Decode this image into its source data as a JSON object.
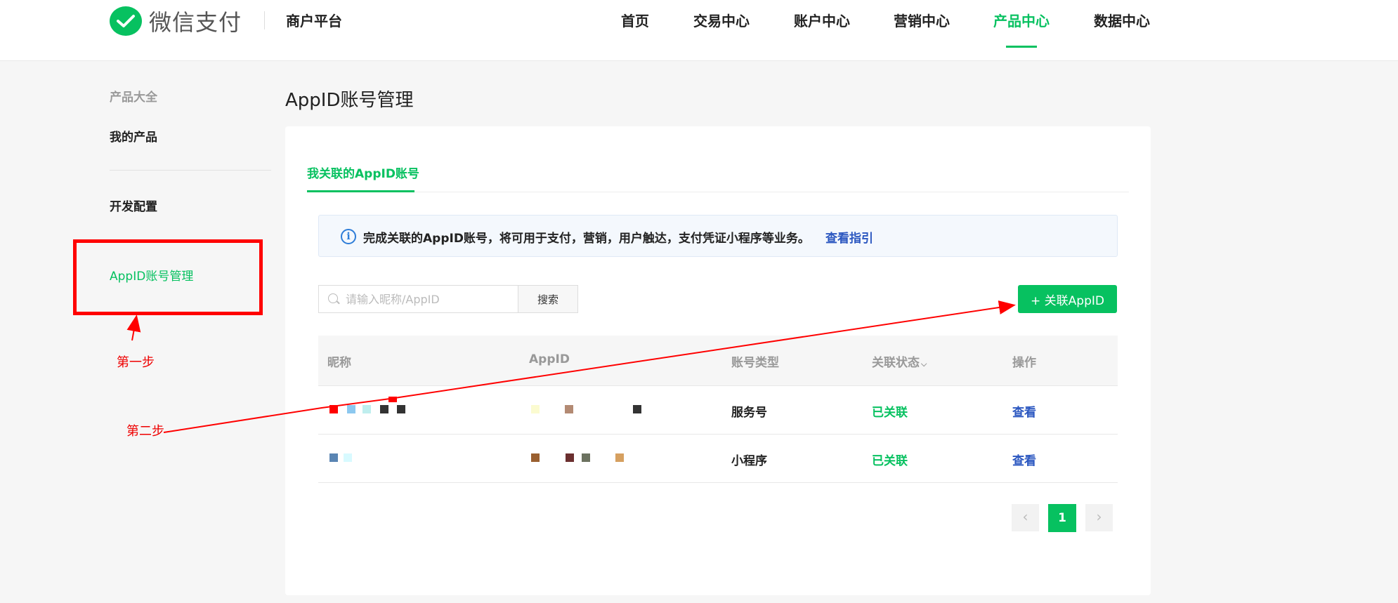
{
  "brand": {
    "name": "微信支付",
    "platform": "商户平台",
    "color": "#07c160"
  },
  "nav": {
    "items": [
      {
        "label": "首页"
      },
      {
        "label": "交易中心"
      },
      {
        "label": "账户中心"
      },
      {
        "label": "营销中心"
      },
      {
        "label": "产品中心",
        "active": true
      },
      {
        "label": "数据中心"
      }
    ]
  },
  "sidebar": {
    "group_label": "产品大全",
    "items": [
      {
        "label": "我的产品"
      },
      {
        "label": "开发配置"
      },
      {
        "label": "AppID账号管理",
        "active": true
      }
    ]
  },
  "annotations": {
    "step1": "第一步",
    "step2": "第二步",
    "color": "#ff0000"
  },
  "main": {
    "title": "AppID账号管理",
    "tab": "我关联的AppID账号",
    "notice": {
      "icon": "info-icon",
      "text": "完成关联的AppID账号，将可用于支付，营销，用户触达，支付凭证小程序等业务。",
      "link": "查看指引"
    },
    "search": {
      "placeholder": "请输入昵称/AppID",
      "button": "搜索"
    },
    "add_button": "+ 关联AppID",
    "table": {
      "headers": [
        "昵称",
        "AppID",
        "账号类型",
        "关联状态",
        "操作"
      ],
      "rows": [
        {
          "type": "服务号",
          "status": "已关联",
          "action": "查看"
        },
        {
          "type": "小程序",
          "status": "已关联",
          "action": "查看"
        }
      ]
    },
    "pagination": {
      "prev": "‹",
      "current": "1",
      "next": "›"
    }
  }
}
